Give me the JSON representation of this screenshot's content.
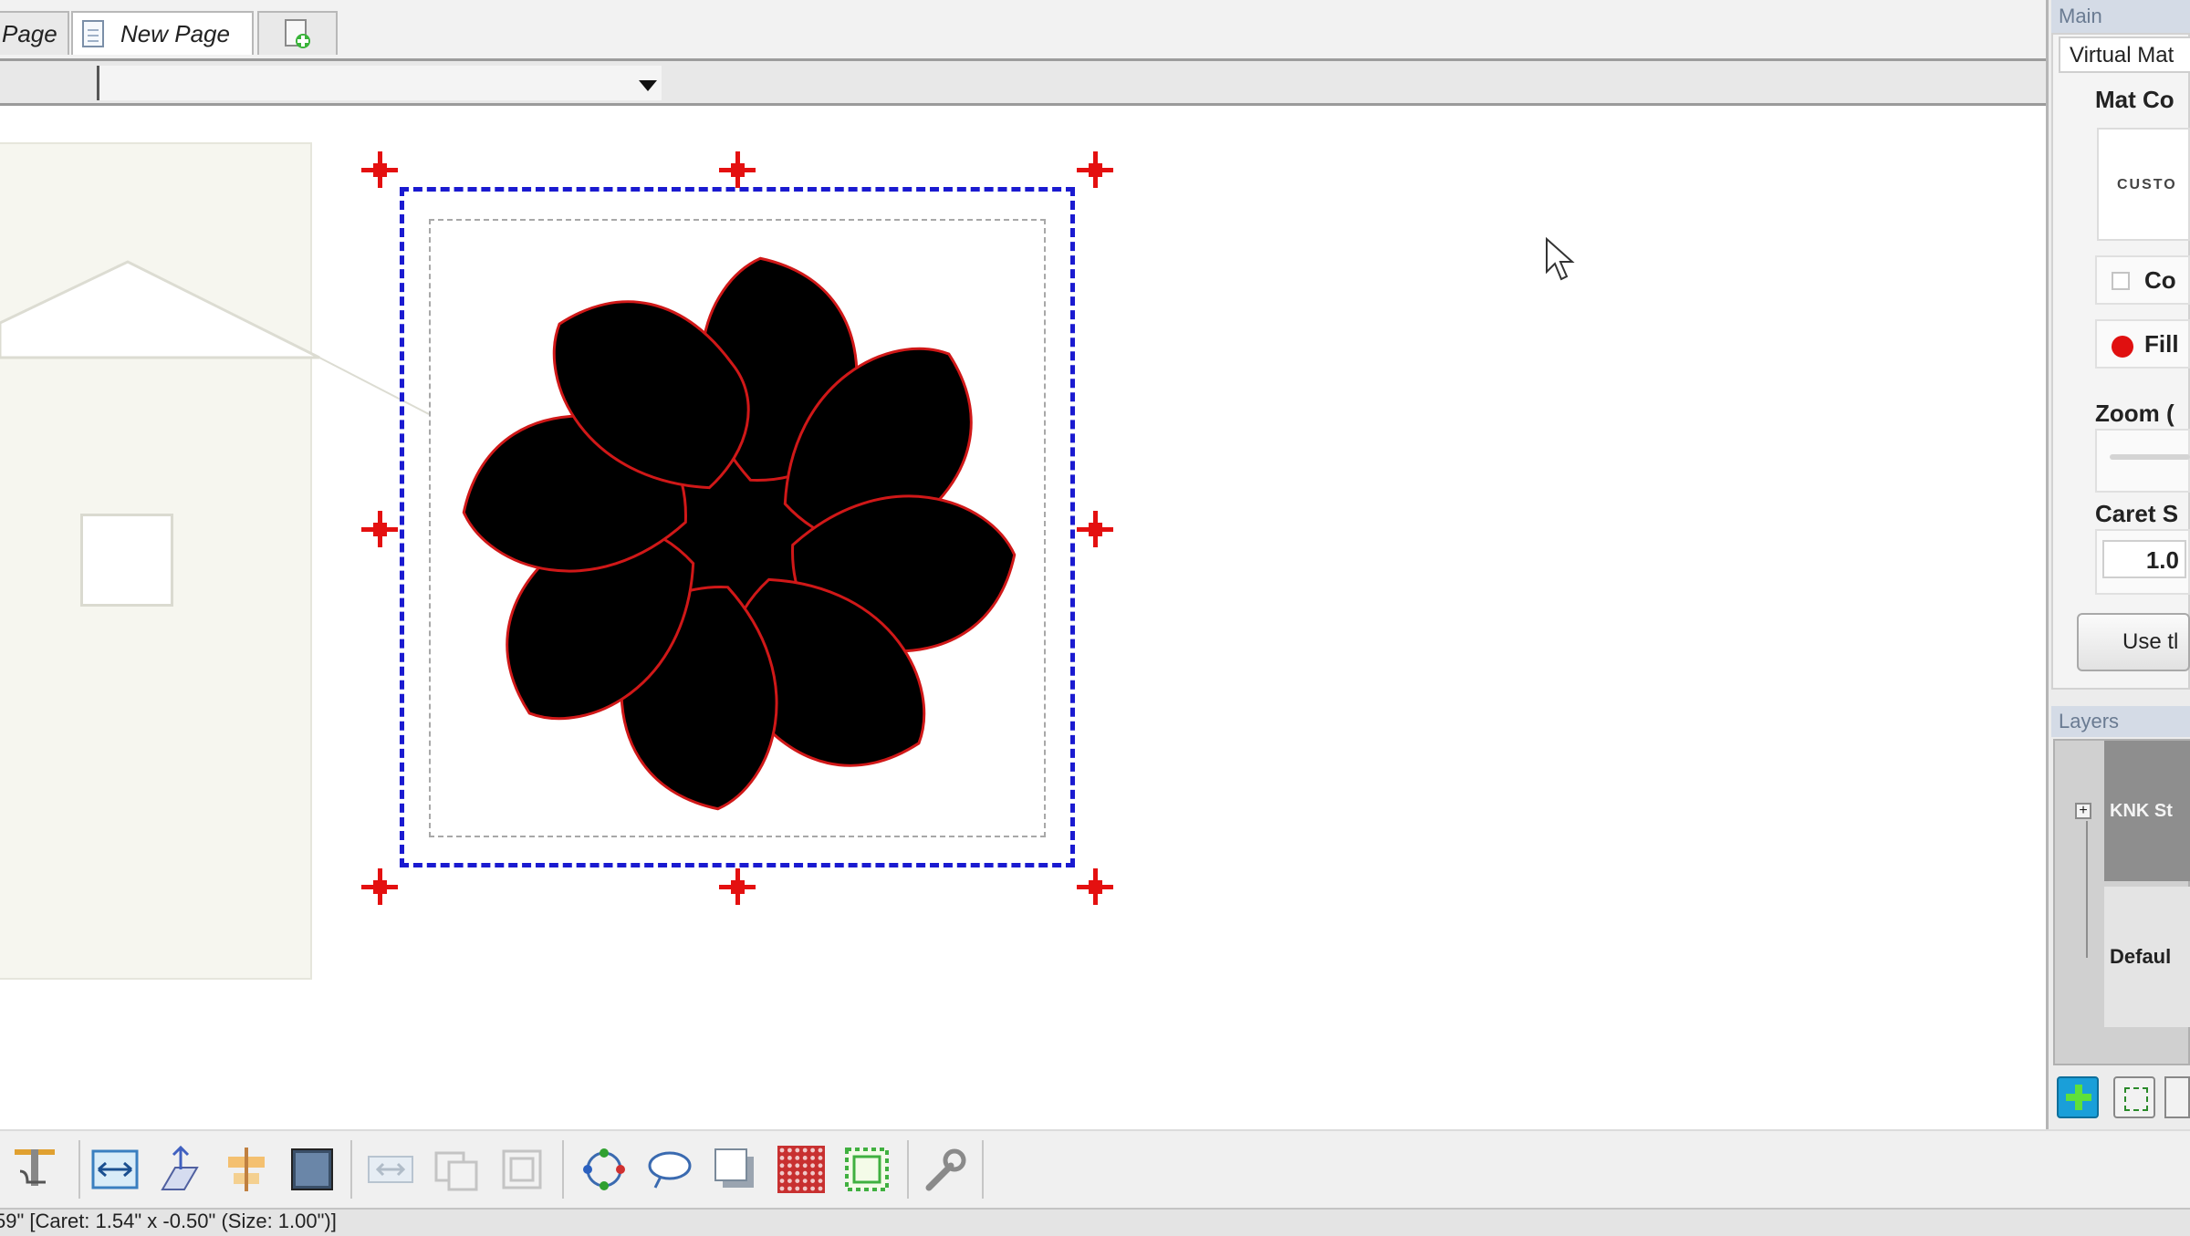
{
  "tabs": [
    {
      "label": "Page",
      "active": false
    },
    {
      "label": "New Page",
      "active": true
    }
  ],
  "right_panel": {
    "main_title": "Main",
    "virtual_mat_tab": "Virtual Mat",
    "mat_color_label": "Mat Co",
    "mat_preview_text": "CUSTO",
    "co_label": "Co",
    "fill_label": "Fill",
    "fill_color": "#e01010",
    "zoom_label": "Zoom (",
    "caret_label": "Caret S",
    "caret_value": "1.0",
    "use_button": "Use tl",
    "layers_title": "Layers",
    "layers": [
      {
        "label": "KNK St",
        "selected": true
      },
      {
        "label": "Defaul",
        "selected": false
      }
    ],
    "layer_expander": "+"
  },
  "toolbar": {
    "tools": [
      "text-tool-icon",
      "flip-horizontal-icon",
      "mirror-icon",
      "align-center-icon",
      "fill-shape-icon",
      "weld-icon",
      "combine-icon",
      "break-apart-icon",
      "node-edit-icon",
      "lasso-icon",
      "shadow-icon",
      "rhinestone-icon",
      "outline-offset-icon",
      "wrench-icon"
    ]
  },
  "status": {
    "text": "59\" [Caret: 1.54\" x -0.50\" (Size: 1.00\")]"
  },
  "colors": {
    "selection_border": "#1a1ad0",
    "handle": "#e41010",
    "flower_fill": "#000000",
    "flower_stroke": "#d01818",
    "accent_panel_header": "#d4dbe6"
  }
}
